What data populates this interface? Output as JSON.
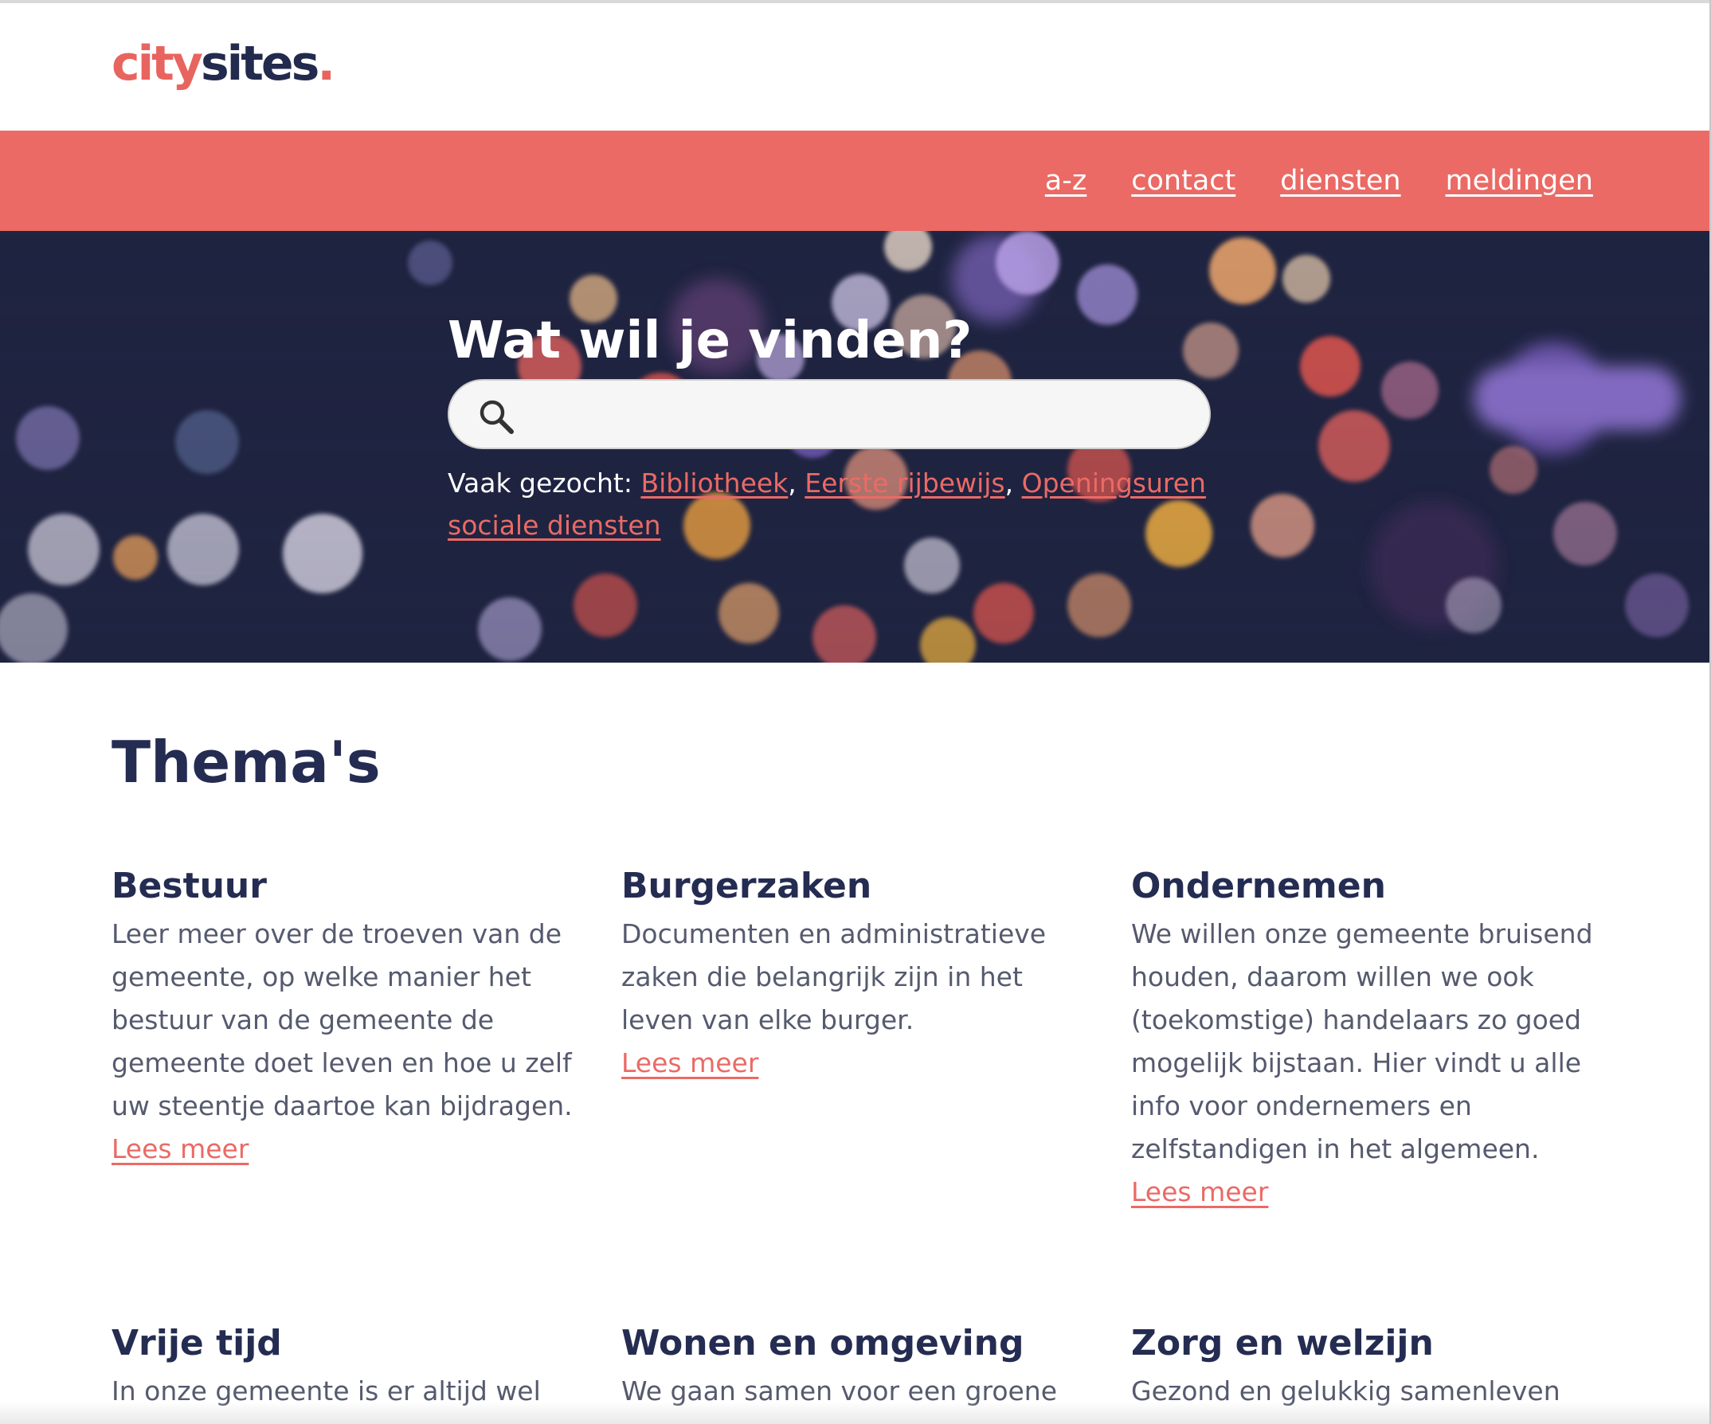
{
  "logo": {
    "part1": "city",
    "part2": "sites",
    "dot": "."
  },
  "nav": {
    "items": [
      "a-z",
      "contact",
      "diensten",
      "meldingen"
    ]
  },
  "hero": {
    "title": "Wat wil je vinden?",
    "search_placeholder": "",
    "popular_label": "Vaak gezocht:",
    "popular_links": [
      "Bibliotheek",
      "Eerste rijbewijs",
      "Openingsuren sociale diensten"
    ]
  },
  "themes": {
    "title": "Thema's",
    "items": [
      {
        "title": "Bestuur",
        "text": "Leer meer over de troeven van de gemeente, op welke manier het bestuur van de gemeente de gemeente doet leven en hoe u zelf uw steentje daartoe kan bijdragen.",
        "link": "Lees meer"
      },
      {
        "title": "Burgerzaken",
        "text": "Documenten en administratieve zaken die belangrijk zijn in het leven van elke burger.",
        "link": "Lees meer"
      },
      {
        "title": "Ondernemen",
        "text": "We willen onze gemeente bruisend houden, daarom willen we ook (toekomstige) handelaars zo goed mogelijk bijstaan. Hier vindt u alle info voor ondernemers en zelfstandigen in het algemeen.",
        "link": "Lees meer"
      },
      {
        "title": "Vrije tijd",
        "text": "In onze gemeente is er altijd wel",
        "link": ""
      },
      {
        "title": "Wonen en omgeving",
        "text": "We gaan samen voor een groene",
        "link": ""
      },
      {
        "title": "Zorg en welzijn",
        "text": "Gezond en gelukkig samenleven",
        "link": ""
      }
    ]
  },
  "colors": {
    "accent": "#eb6a65",
    "navy": "#242c52",
    "hero_bg": "#1d2340"
  }
}
